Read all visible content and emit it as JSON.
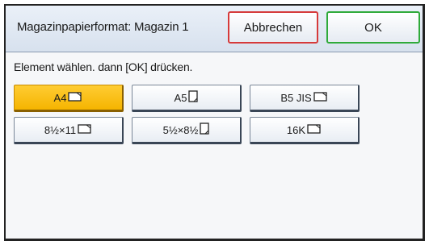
{
  "header": {
    "title": "Magazinpapierformat: Magazin 1",
    "cancel_label": "Abbrechen",
    "ok_label": "OK"
  },
  "instruction": "Element wählen. dann [OK] drücken.",
  "paper_sizes": [
    {
      "label": "A4",
      "orientation": "landscape",
      "selected": true
    },
    {
      "label": "A5",
      "orientation": "portrait",
      "selected": false
    },
    {
      "label": "B5 JIS",
      "orientation": "landscape",
      "selected": false
    },
    {
      "label": "8½×11",
      "orientation": "landscape",
      "selected": false
    },
    {
      "label": "5½×8½",
      "orientation": "portrait",
      "selected": false
    },
    {
      "label": "16K",
      "orientation": "landscape",
      "selected": false
    }
  ],
  "colors": {
    "selected": "#f5b400",
    "cancel_border": "#d63a3a",
    "ok_border": "#2faa3a"
  }
}
